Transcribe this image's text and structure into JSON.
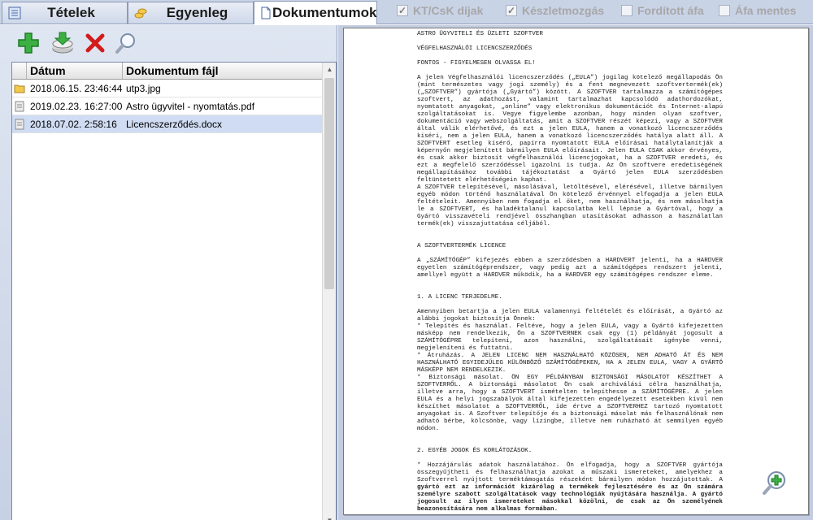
{
  "tabs": [
    {
      "label": "Tételek",
      "icon": "list-icon",
      "active": false
    },
    {
      "label": "Egyenleg",
      "icon": "coins-icon",
      "active": false
    },
    {
      "label": "Dokumentumok",
      "icon": "document-icon",
      "active": true
    }
  ],
  "checkboxes": [
    {
      "label": "KT/CsK díjak",
      "checked": true
    },
    {
      "label": "Készletmozgás",
      "checked": true
    },
    {
      "label": "Fordított áfa",
      "checked": false
    },
    {
      "label": "Áfa mentes",
      "checked": false
    }
  ],
  "toolbar": {
    "add_icon": "add-icon",
    "download_icon": "download-icon",
    "delete_icon": "delete-icon",
    "search_icon": "search-icon"
  },
  "grid": {
    "columns": [
      "Dátum",
      "Dokumentum fájl"
    ],
    "rows": [
      {
        "date": "2018.06.15. 23:46:44",
        "file": "utp3.jpg",
        "icon": "folder-icon",
        "selected": false
      },
      {
        "date": "2019.02.23. 16:27:00",
        "file": "Astro ügyvitel - nyomtatás.pdf",
        "icon": "doc-file-icon",
        "selected": false
      },
      {
        "date": "2018.07.02. 2:58:16",
        "file": "Licencszerződés.docx",
        "icon": "doc-file-icon",
        "selected": true
      }
    ]
  },
  "document": {
    "company": "ASTRO ÜGYVITELI ÉS ÜZLETI SZOFTVER",
    "title": "VÉGFELHASZNÁLÓI LICENCSZERZŐDÉS",
    "warning": "FONTOS - FIGYELMESEN OLVASSA EL!",
    "p1": "A jelen Végfelhasználói licencszerződés („EULA”) jogilag kötelező megállapodás Ön (mint természetes vagy jogi személy) és a fent megnevezett szoftvertermék(ek) („SZOFTVER”) gyártója („Gyártó”) között. A SZOFTVER tartalmazza a számítógépes szoftvert, az adathozást, valamint tartalmazhat kapcsolódó adathordozókat, nyomtatott anyagokat, „online” vagy elektronikus dokumentációt és Internet-alapú szolgáltatásokat is. Vegye figyelembe azonban, hogy minden olyan szoftver, dokumentáció vagy webszolgáltatás, amit a SZOFTVER részét képezi, vagy a SZOFTVER által válik elérhetővé, és ezt a jelen EULA, hanem a vonatkozó licencszerződés kiséri, nem a jelen EULA, hanem a vonatkozó licencszerződés hatálya alatt áll. A SZOFTVERT esetleg kísérő, papírra nyomtatott EULA előírásai hatálytalanítják a képernyőn megjelenített bármilyen EULA előírásait. Jelen EULA CSAK akkor érvényes, és csak akkor biztosít végfelhasználói licencjogokat, ha a SZOFTVER eredeti, és ezt a megfelelő szerződéssel igazolni is tudja. Az Ön szoftvere eredetiségének megállapításához további tájékoztatást a Gyártó jelen EULA szerződésben feltüntetett elérhetőségein kaphat.",
    "p2": "A SZOFTVER telepítésével, másolásával, letöltésével, elérésével, illetve bármilyen egyéb módon történő használatával Ön kötelező érvénnyel elfogadja a jelen EULA feltételeit. Amennyiben nem fogadja el őket, nem használhatja, és nem másolhatja le a SZOFTVERT, és haladéktalanul kapcsolatba kell lépnie a Gyártóval, hogy a Gyártó visszavételi rendjével összhangban utasításokat adhasson a használatlan termék(ek) visszajuttatása céljából.",
    "h_product": "A SZOFTVERTERMÉK LICENCE",
    "p3": "A „SZÁMÍTÓGÉP” kifejezés ebben a szerződésben a HARDVERT jelenti, ha a HARDVER egyetlen számítógéprendszer, vagy pedig azt a számítógépes rendszert jelenti, amellyel együtt a HARDVER működik, ha a HARDVER egy számítógépes rendszer eleme.",
    "h_scope": "1. A LICENC TERJEDELME.",
    "p4": "Amennyiben betartja a jelen EULA valamennyi feltételét és előírását, a Gyártó az alábbi jogokat biztosítja Önnek:",
    "p5": "* Telepítés és használat. Feltéve, hogy a jelen EULA, vagy a Gyártó kifejezetten másképp nem rendelkezik, Ön a SZOFTVERNEK csak egy (1) példányát jogosult a SZÁMÍTÓGÉPRE telepíteni, azon használni, szolgáltatásait igénybe venni, megjeleníteni és futtatni.",
    "p6": "* Átruházás. A JELEN LICENC NEM HASZNÁLHATÓ KÖZÖSEN, NEM ADHATÓ ÁT ÉS NEM HASZNÁLHATÓ EGYIDEJŰLEG KÜLÖNBÖZŐ SZÁMÍTÓGÉPEKEN, HA A JELEN EULA, VAGY A GYÁRTÓ MÁSKÉPP NEM RENDELKEZIK.",
    "p7": "* Biztonsági másolat. ÖN EGY PÉLDÁNYBAN BIZTONSÁGI MÁSOLATOT KÉSZÍTHET A SZOFTVERRŐL. A biztonsági másolatot Ön csak archiválási célra használhatja, illetve arra, hogy a SZOFTVERT ismételten telepíthesse a SZÁMÍTÓGÉPRE. A jelen EULA és a helyi jogszabályok által kifejezetten engedélyezett esetekben kívül nem készíthet másolatot a SZOFTVERRŐL, ide értve a SZOFTVERHEZ tartozó nyomtatott anyagokat is. A Szoftver telepítője és a biztonsági másolat más felhasználónak nem adható bérbe, kölcsönbe, vagy lízingbe, illetve nem ruházható át semmilyen egyéb módon.",
    "h_other": "2. EGYÉB JOGOK ÉS KORLÁTOZÁSOK.",
    "p8": "* Hozzájárulás adatok használatához. Ön elfogadja, hogy a SZOFTVER gyártója összegyűjtheti és felhasználhatja azokat a műszaki ismereteket, amelyekhez a Szoftverrel nyújtott terméktámogatás részeként bármilyen módon hozzájutottak. A",
    "p8b": "gyártó ezt az információt kizárólag a termékek fejlesztésére és az Ön számára személyre szabott szolgáltatások vagy technológiák nyújtására használja. A gyártó jogosult az ilyen ismereteket másokkal közölni, de csak az Ön személyének beazonosítására nem alkalmas formában.",
    "zoom_icon": "zoom-in-icon"
  }
}
